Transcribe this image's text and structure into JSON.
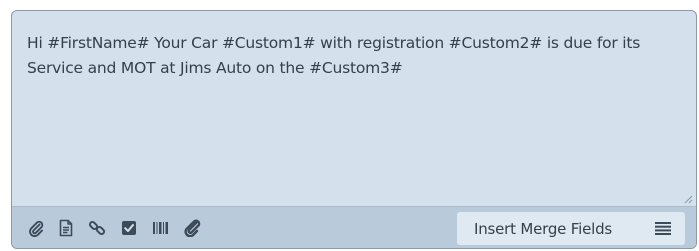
{
  "editor": {
    "message": "Hi #FirstName# Your Car #Custom1# with registration #Custom2# is due for its Service and MOT at Jims Auto on the #Custom3#"
  },
  "toolbar": {
    "icons": [
      "paperclip-icon",
      "document-icon",
      "link-icon",
      "checkbox-icon",
      "barcode-icon",
      "attachment-icon",
      "list-icon"
    ],
    "merge_label": "Insert Merge Fields"
  },
  "colors": {
    "editor_bg": "#d4e1ec",
    "toolbar_bg": "#b9cbdb",
    "text": "#34404b",
    "icon": "#3d4a57"
  }
}
